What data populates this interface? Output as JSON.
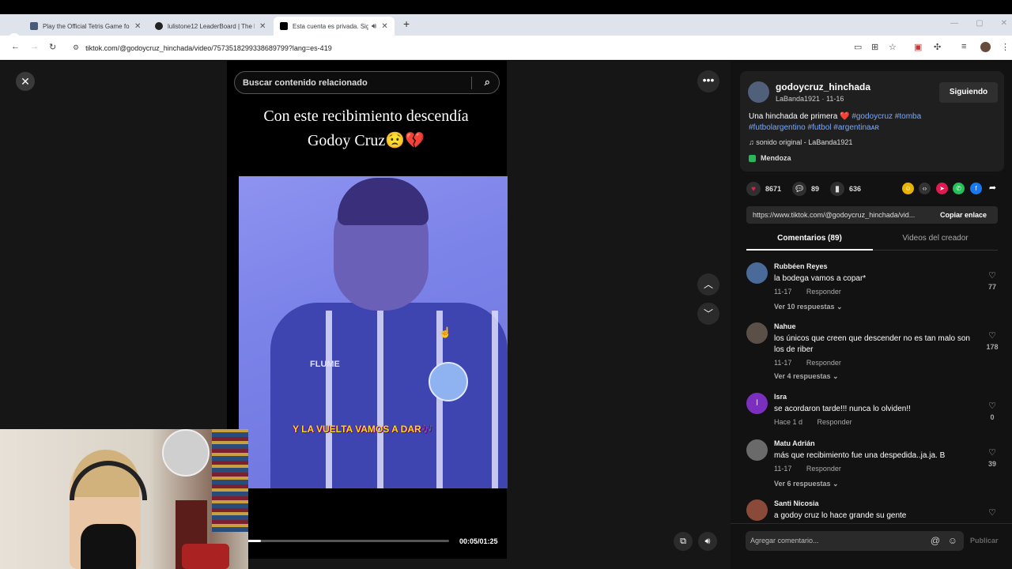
{
  "browser": {
    "tabs": [
      {
        "title": "Play the Official Tetris Game fo",
        "favicon_color": "#4a5a7a",
        "active": false
      },
      {
        "title": "lulistone12 LeaderBoard | The l",
        "favicon_color": "#222222",
        "active": false
      },
      {
        "title": "Esta cuenta es privada. Sigu",
        "favicon_color": "#000000",
        "active": true
      }
    ],
    "url": "tiktok.com/@godoycruz_hinchada/video/7573518299338689799?lang=es-419"
  },
  "video": {
    "search_placeholder": "Buscar contenido relacionado",
    "caption_line1": "Con este recibimiento descendía",
    "caption_line2": "Godoy Cruz😟💔",
    "jersey_brand": "FLUME",
    "overlay_text": "Y LA VUELTA VAMOS A DAR🎶",
    "time": "00:05/01:25",
    "progress": 0.067
  },
  "post": {
    "username": "godoycruz_hinchada",
    "subtitle": "LaBanda1921 · 11-16",
    "follow_label": "Siguiendo",
    "desc_text": "Una hinchada de primera",
    "desc_heart": "❤️",
    "tags_line1": "#godoycruz #tomba",
    "tags_line2": "#futbolargentino #futbol #argentinaᴀʀ",
    "music": "sonido original - LaBanda1921",
    "location": "Mendoza",
    "likes": "8671",
    "comments": "89",
    "saves": "636",
    "link": "https://www.tiktok.com/@godoycruz_hinchada/vid...",
    "copy_label": "Copiar enlace",
    "tab_comments": "Comentarios (89)",
    "tab_videos": "Videos del creador"
  },
  "comments": [
    {
      "name": "Rubbéen Reyes",
      "text": "la bodega vamos a copar*",
      "date": "11-17",
      "reply": "Responder",
      "likes": "77",
      "replies": "Ver 10 respuestas ⌄",
      "avatar_color": "#4a6a9a",
      "initial": ""
    },
    {
      "name": "Nahue",
      "text": "los únicos que creen que descender no es tan malo son los de riber",
      "date": "11-17",
      "reply": "Responder",
      "likes": "178",
      "replies": "Ver 4 respuestas ⌄",
      "avatar_color": "#5a5048",
      "initial": ""
    },
    {
      "name": "Isra",
      "text": "se acordaron tarde!!! nunca lo olviden!!",
      "date": "Hace 1 d",
      "reply": "Responder",
      "likes": "0",
      "replies": "",
      "avatar_color": "#7b2fbf",
      "initial": "I"
    },
    {
      "name": "Matu Adrián",
      "text": "más que recibimiento fue una despedida..ja.ja. B",
      "date": "11-17",
      "reply": "Responder",
      "likes": "39",
      "replies": "Ver 6 respuestas ⌄",
      "avatar_color": "#6a6a6a",
      "initial": ""
    },
    {
      "name": "Santi Nicosia",
      "text": "a godoy cruz lo hace grande su gente",
      "date": "",
      "reply": "",
      "likes": "",
      "replies": "",
      "avatar_color": "#8a4a3a",
      "initial": ""
    }
  ],
  "comment_input": {
    "placeholder": "Agregar comentario...",
    "publish": "Publicar"
  },
  "icons": {
    "close": "close-icon",
    "more": "more-icon",
    "up": "chevron-up-icon",
    "down": "chevron-down-icon"
  }
}
